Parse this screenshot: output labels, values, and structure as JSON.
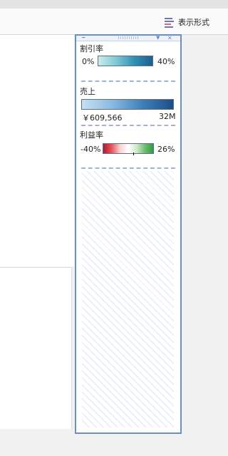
{
  "toolbar": {
    "format_label": "表示形式",
    "format_icon": "format-lines-icon"
  },
  "legend_panel": {
    "icons": {
      "pin": "pin-icon",
      "grip": "grip-icon",
      "menu": "dropdown-arrow-icon",
      "close": "close-icon"
    },
    "discount": {
      "title": "割引率",
      "min": "0%",
      "max": "40%"
    },
    "sales": {
      "title": "売上",
      "min": "￥609,566",
      "max": "32M"
    },
    "profit": {
      "title": "利益率",
      "min": "-40%",
      "max": "26%"
    }
  },
  "colors": {
    "panel_border": "#6d8fbf",
    "discount_ramp": [
      "#c9ecea",
      "#1f5e8f"
    ],
    "sales_ramp": [
      "#c7e0f3",
      "#1d4e86"
    ],
    "profit_ramp": [
      "#b2182b",
      "#ffffff",
      "#2f9a46"
    ]
  }
}
